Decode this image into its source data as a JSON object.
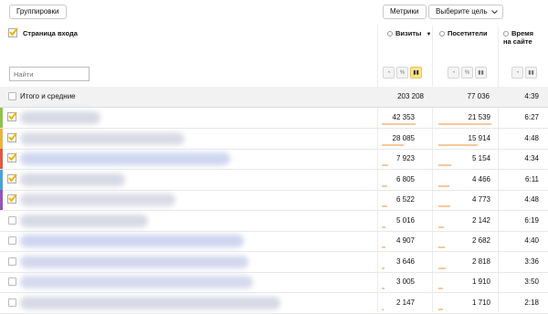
{
  "toolbar": {
    "groupings_label": "Группировки",
    "metrics_label": "Метрики",
    "goal_label": "Выберите цель"
  },
  "header": {
    "dimension_label": "Страница входа",
    "col_visits": "Визиты",
    "col_visitors": "Посетители",
    "col_time_line1": "Время",
    "col_time_line2": "на сайте",
    "sort_indicator": "▼"
  },
  "search": {
    "placeholder": "Найти"
  },
  "vis_icons": [
    "pie-icon",
    "percent-icon",
    "bar-icon"
  ],
  "totals": {
    "label": "Итого и средние",
    "visits": "203 208",
    "visitors": "77 036",
    "time": "4:39"
  },
  "rows": [
    {
      "checked": true,
      "color": "#8fc63e",
      "visits": "42 353",
      "visitors": "21 539",
      "time": "6:27",
      "visits_bar": 1.0,
      "visitors_bar": 1.0
    },
    {
      "checked": true,
      "color": "#f2b233",
      "visits": "28 085",
      "visitors": "15 914",
      "time": "4:48",
      "visits_bar": 0.66,
      "visitors_bar": 0.74
    },
    {
      "checked": true,
      "color": "#e8553d",
      "visits": "7 923",
      "visitors": "5 154",
      "time": "4:34",
      "visits_bar": 0.19,
      "visitors_bar": 0.24
    },
    {
      "checked": true,
      "color": "#3fa5de",
      "visits": "6 805",
      "visitors": "4 466",
      "time": "6:11",
      "visits_bar": 0.16,
      "visitors_bar": 0.21
    },
    {
      "checked": true,
      "color": "#9a4ec2",
      "visits": "6 522",
      "visitors": "4 773",
      "time": "4:48",
      "visits_bar": 0.15,
      "visitors_bar": 0.22
    },
    {
      "checked": false,
      "color": "",
      "visits": "5 016",
      "visitors": "2 142",
      "time": "6:19",
      "visits_bar": 0.12,
      "visitors_bar": 0.1
    },
    {
      "checked": false,
      "color": "",
      "visits": "4 907",
      "visitors": "2 682",
      "time": "4:40",
      "visits_bar": 0.12,
      "visitors_bar": 0.12
    },
    {
      "checked": false,
      "color": "",
      "visits": "3 646",
      "visitors": "2 818",
      "time": "3:36",
      "visits_bar": 0.09,
      "visitors_bar": 0.13
    },
    {
      "checked": false,
      "color": "",
      "visits": "3 005",
      "visitors": "1 910",
      "time": "3:50",
      "visits_bar": 0.07,
      "visitors_bar": 0.09
    },
    {
      "checked": false,
      "color": "",
      "visits": "2 147",
      "visitors": "1 710",
      "time": "2:18",
      "visits_bar": 0.05,
      "visitors_bar": 0.08
    }
  ],
  "colors": {
    "accent_yellow": "#ffe38a",
    "bar": "#f6c89a",
    "check": "#f0b400"
  }
}
